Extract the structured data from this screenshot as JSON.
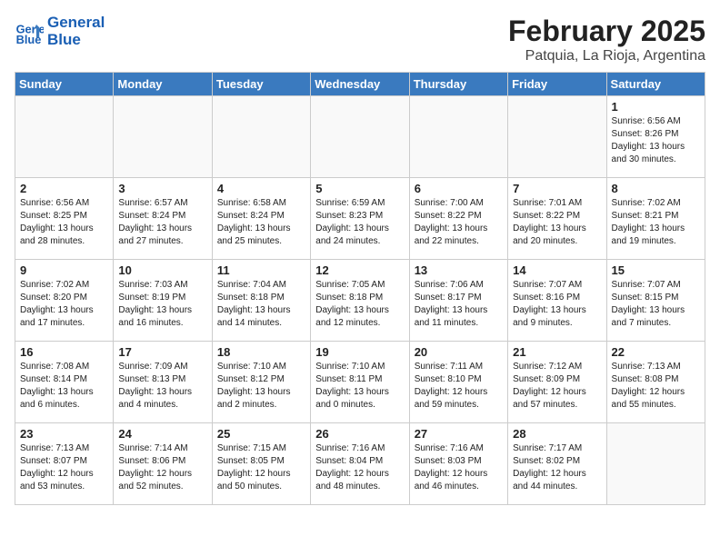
{
  "header": {
    "logo_line1": "General",
    "logo_line2": "Blue",
    "month": "February 2025",
    "location": "Patquia, La Rioja, Argentina"
  },
  "weekdays": [
    "Sunday",
    "Monday",
    "Tuesday",
    "Wednesday",
    "Thursday",
    "Friday",
    "Saturday"
  ],
  "weeks": [
    [
      {
        "day": "",
        "info": ""
      },
      {
        "day": "",
        "info": ""
      },
      {
        "day": "",
        "info": ""
      },
      {
        "day": "",
        "info": ""
      },
      {
        "day": "",
        "info": ""
      },
      {
        "day": "",
        "info": ""
      },
      {
        "day": "1",
        "info": "Sunrise: 6:56 AM\nSunset: 8:26 PM\nDaylight: 13 hours\nand 30 minutes."
      }
    ],
    [
      {
        "day": "2",
        "info": "Sunrise: 6:56 AM\nSunset: 8:25 PM\nDaylight: 13 hours\nand 28 minutes."
      },
      {
        "day": "3",
        "info": "Sunrise: 6:57 AM\nSunset: 8:24 PM\nDaylight: 13 hours\nand 27 minutes."
      },
      {
        "day": "4",
        "info": "Sunrise: 6:58 AM\nSunset: 8:24 PM\nDaylight: 13 hours\nand 25 minutes."
      },
      {
        "day": "5",
        "info": "Sunrise: 6:59 AM\nSunset: 8:23 PM\nDaylight: 13 hours\nand 24 minutes."
      },
      {
        "day": "6",
        "info": "Sunrise: 7:00 AM\nSunset: 8:22 PM\nDaylight: 13 hours\nand 22 minutes."
      },
      {
        "day": "7",
        "info": "Sunrise: 7:01 AM\nSunset: 8:22 PM\nDaylight: 13 hours\nand 20 minutes."
      },
      {
        "day": "8",
        "info": "Sunrise: 7:02 AM\nSunset: 8:21 PM\nDaylight: 13 hours\nand 19 minutes."
      }
    ],
    [
      {
        "day": "9",
        "info": "Sunrise: 7:02 AM\nSunset: 8:20 PM\nDaylight: 13 hours\nand 17 minutes."
      },
      {
        "day": "10",
        "info": "Sunrise: 7:03 AM\nSunset: 8:19 PM\nDaylight: 13 hours\nand 16 minutes."
      },
      {
        "day": "11",
        "info": "Sunrise: 7:04 AM\nSunset: 8:18 PM\nDaylight: 13 hours\nand 14 minutes."
      },
      {
        "day": "12",
        "info": "Sunrise: 7:05 AM\nSunset: 8:18 PM\nDaylight: 13 hours\nand 12 minutes."
      },
      {
        "day": "13",
        "info": "Sunrise: 7:06 AM\nSunset: 8:17 PM\nDaylight: 13 hours\nand 11 minutes."
      },
      {
        "day": "14",
        "info": "Sunrise: 7:07 AM\nSunset: 8:16 PM\nDaylight: 13 hours\nand 9 minutes."
      },
      {
        "day": "15",
        "info": "Sunrise: 7:07 AM\nSunset: 8:15 PM\nDaylight: 13 hours\nand 7 minutes."
      }
    ],
    [
      {
        "day": "16",
        "info": "Sunrise: 7:08 AM\nSunset: 8:14 PM\nDaylight: 13 hours\nand 6 minutes."
      },
      {
        "day": "17",
        "info": "Sunrise: 7:09 AM\nSunset: 8:13 PM\nDaylight: 13 hours\nand 4 minutes."
      },
      {
        "day": "18",
        "info": "Sunrise: 7:10 AM\nSunset: 8:12 PM\nDaylight: 13 hours\nand 2 minutes."
      },
      {
        "day": "19",
        "info": "Sunrise: 7:10 AM\nSunset: 8:11 PM\nDaylight: 13 hours\nand 0 minutes."
      },
      {
        "day": "20",
        "info": "Sunrise: 7:11 AM\nSunset: 8:10 PM\nDaylight: 12 hours\nand 59 minutes."
      },
      {
        "day": "21",
        "info": "Sunrise: 7:12 AM\nSunset: 8:09 PM\nDaylight: 12 hours\nand 57 minutes."
      },
      {
        "day": "22",
        "info": "Sunrise: 7:13 AM\nSunset: 8:08 PM\nDaylight: 12 hours\nand 55 minutes."
      }
    ],
    [
      {
        "day": "23",
        "info": "Sunrise: 7:13 AM\nSunset: 8:07 PM\nDaylight: 12 hours\nand 53 minutes."
      },
      {
        "day": "24",
        "info": "Sunrise: 7:14 AM\nSunset: 8:06 PM\nDaylight: 12 hours\nand 52 minutes."
      },
      {
        "day": "25",
        "info": "Sunrise: 7:15 AM\nSunset: 8:05 PM\nDaylight: 12 hours\nand 50 minutes."
      },
      {
        "day": "26",
        "info": "Sunrise: 7:16 AM\nSunset: 8:04 PM\nDaylight: 12 hours\nand 48 minutes."
      },
      {
        "day": "27",
        "info": "Sunrise: 7:16 AM\nSunset: 8:03 PM\nDaylight: 12 hours\nand 46 minutes."
      },
      {
        "day": "28",
        "info": "Sunrise: 7:17 AM\nSunset: 8:02 PM\nDaylight: 12 hours\nand 44 minutes."
      },
      {
        "day": "",
        "info": ""
      }
    ]
  ]
}
